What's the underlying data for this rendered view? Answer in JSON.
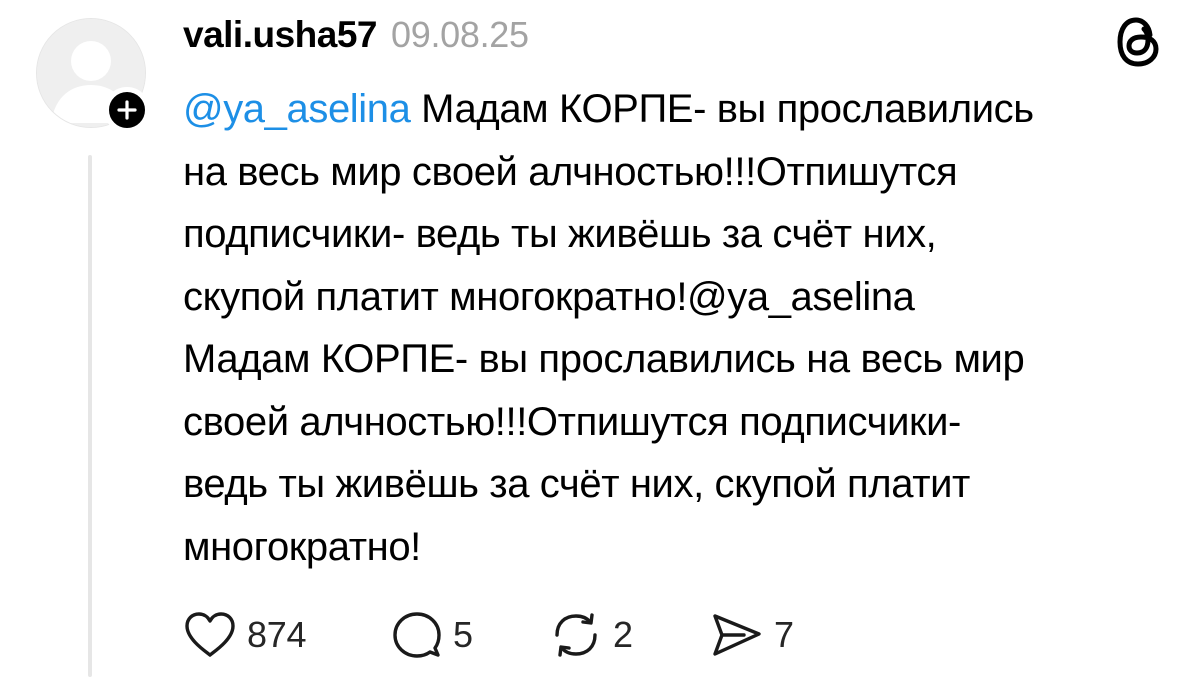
{
  "post": {
    "author": {
      "username": "vali.usha57",
      "timestamp": "09.08.25",
      "avatar_icon": "default-avatar-icon",
      "follow_icon": "plus-icon"
    },
    "app_icon": "threads-logo-icon",
    "text": {
      "line1_mention": "@ya_aselina",
      "line1_rest": " Мадам КОРПЕ- вы прославились",
      "line2": "на весь мир своей алчностью!!!Отпишутся",
      "line3": "подписчики- ведь ты живёшь за счёт них,",
      "line4": "скупой платит многократно!@ya_aselina",
      "line5": "Мадам КОРПЕ- вы прославились на весь мир",
      "line6": "своей алчностью!!!Отпишутся подписчики-",
      "line7": "ведь ты живёшь за счёт них, скупой платит",
      "line8": "многократно!"
    },
    "actions": {
      "like": {
        "icon": "heart-icon",
        "count": "874"
      },
      "reply": {
        "icon": "comment-icon",
        "count": "5"
      },
      "repost": {
        "icon": "repost-icon",
        "count": "2"
      },
      "share": {
        "icon": "send-icon",
        "count": "7"
      }
    },
    "colors": {
      "mention": "#1d8fe6",
      "timestamp": "#a3a3a3",
      "thread_line": "#e6e6e6"
    }
  }
}
